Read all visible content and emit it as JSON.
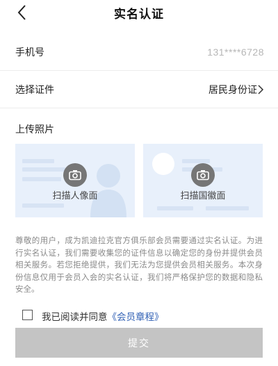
{
  "header": {
    "title": "实名认证"
  },
  "phone": {
    "label": "手机号",
    "value": "131****6728"
  },
  "id_type": {
    "label": "选择证件",
    "value": "居民身份证"
  },
  "upload": {
    "label": "上传照片",
    "portrait_label": "扫描人像面",
    "emblem_label": "扫描国徽面"
  },
  "description": "尊敬的用户，成为凯迪拉克官方俱乐部会员需要通过实名认证。为进行实名认证，我们需要收集您的证件信息以确定您的身份并提供会员相关服务。若您拒绝提供，我们无法为您提供会员相关服务。本次身份信息仅用于会员入会的实名认证，我们将严格保护您的数据和隐私安全。",
  "agreement": {
    "text": "我已阅读并同意",
    "link": "《会员章程》",
    "checked": false
  },
  "submit": {
    "label": "提交"
  },
  "colors": {
    "link": "#2f5fb4",
    "card_bg": "#e8f0fb",
    "disabled_button": "#c4c4c4"
  }
}
